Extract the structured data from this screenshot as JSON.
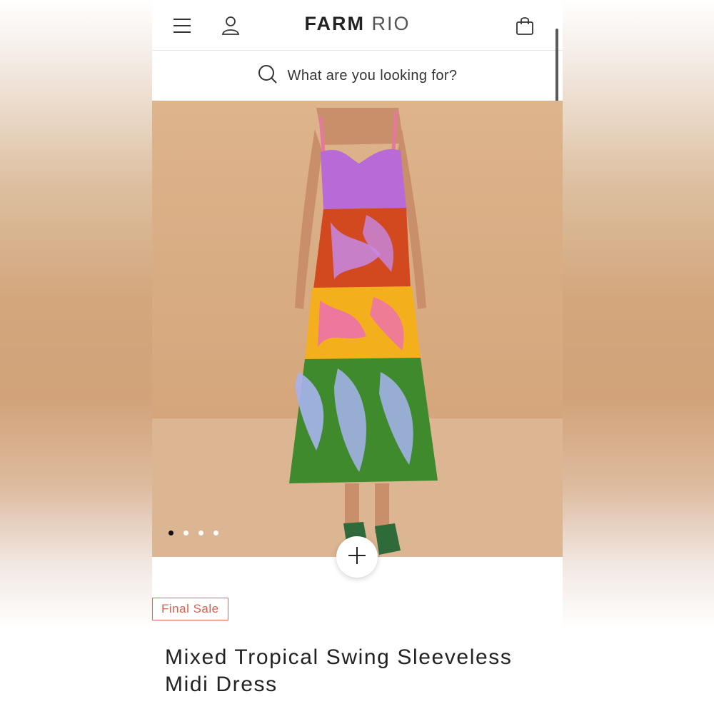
{
  "header": {
    "logo_primary": "FARM",
    "logo_secondary": "RIO",
    "menu_icon": "hamburger-menu-icon",
    "account_icon": "user-icon",
    "cart_icon": "shopping-bag-icon"
  },
  "search": {
    "placeholder": "What are you looking for?",
    "icon": "search-icon"
  },
  "product": {
    "gallery": {
      "image_count": 4,
      "active_index": 0
    },
    "add_icon": "plus-icon",
    "badge": "Final Sale",
    "title": "Mixed Tropical Swing Sleeveless Midi Dress"
  },
  "colors": {
    "badge": "#d9604f",
    "backdrop": "#d8ab82"
  }
}
